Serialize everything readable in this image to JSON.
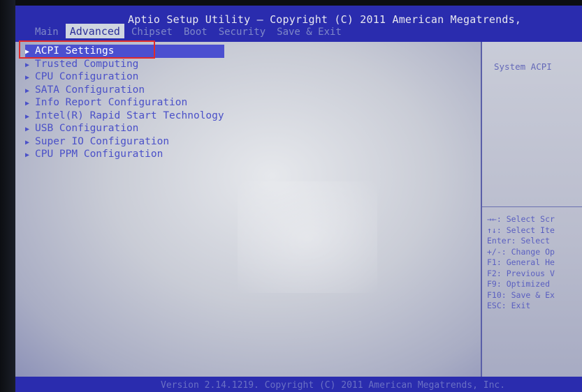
{
  "header": {
    "title": "Aptio Setup Utility – Copyright (C) 2011 American Megatrends,",
    "tabs": [
      "Main",
      "Advanced",
      "Chipset",
      "Boot",
      "Security",
      "Save & Exit"
    ],
    "active_tab": "Advanced"
  },
  "menu": {
    "items": [
      "ACPI Settings",
      "Trusted Computing",
      "CPU Configuration",
      "SATA Configuration",
      "Info Report Configuration",
      "Intel(R) Rapid Start Technology",
      "USB Configuration",
      "Super IO Configuration",
      "CPU PPM Configuration"
    ],
    "selected": "ACPI Settings"
  },
  "help": {
    "description": "System ACPI",
    "keys": [
      "→←: Select Scr",
      "↑↓: Select Ite",
      "Enter: Select",
      "+/-: Change Op",
      "F1: General He",
      "F2: Previous V",
      "F9: Optimized",
      "F10: Save & Ex",
      "ESC: Exit"
    ]
  },
  "footer": {
    "text": "Version 2.14.1219. Copyright (C) 2011 American Megatrends, Inc."
  },
  "colors": {
    "title_bar": "#2a2cae",
    "highlight": "#4b4fd0",
    "menu_text": "#4a50c8",
    "annotation_box": "#e02a2a"
  }
}
